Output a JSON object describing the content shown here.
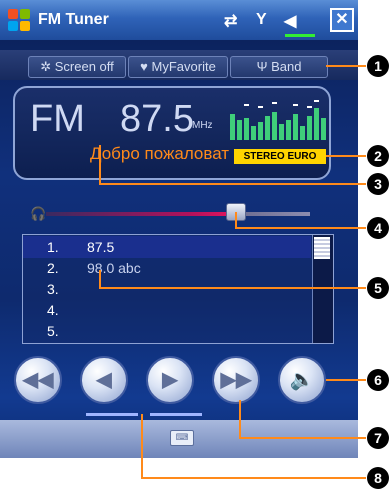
{
  "window": {
    "title": "FM Tuner",
    "close_label": "✕"
  },
  "toolbar": {
    "screen_off": "Screen off",
    "favorite": "MyFavorite",
    "band": "Band"
  },
  "display": {
    "band": "FM",
    "frequency": "87.5",
    "unit": "MHz",
    "welcome": "Добро пожаловат",
    "badge": "STEREO EURO"
  },
  "presets": [
    {
      "num": "1.",
      "text": "87.5",
      "selected": true
    },
    {
      "num": "2.",
      "text": "98.0  abc",
      "selected": false
    },
    {
      "num": "3.",
      "text": "",
      "selected": false
    },
    {
      "num": "4.",
      "text": "",
      "selected": false
    },
    {
      "num": "5.",
      "text": "",
      "selected": false
    }
  ],
  "controls": {
    "rewind": "◀◀",
    "prev": "◀",
    "next": "▶",
    "forward": "▶▶",
    "mute": "🔈"
  },
  "callouts": [
    "1",
    "2",
    "3",
    "4",
    "5",
    "6",
    "7",
    "8"
  ],
  "colors": {
    "accent": "#ff8a1a",
    "badge": "#ffd400",
    "volume": "#e0145e"
  }
}
